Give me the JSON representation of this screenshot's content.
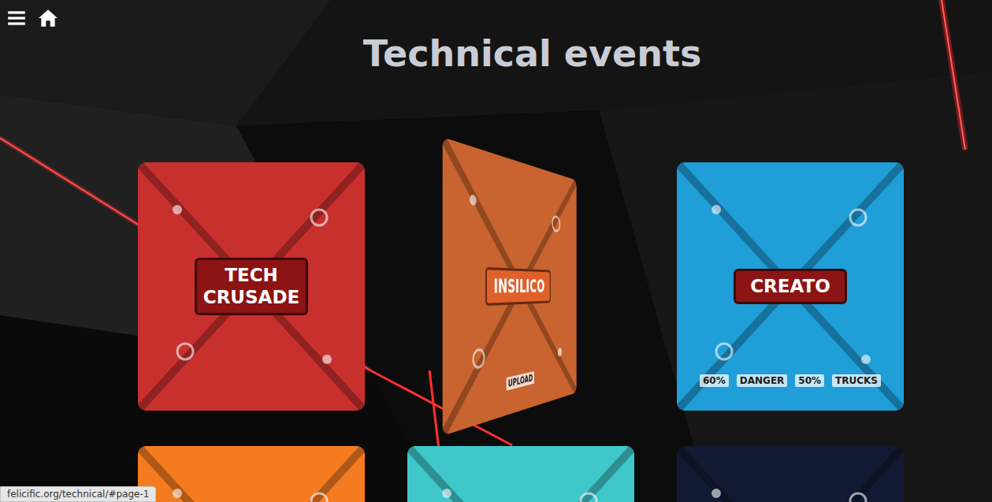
{
  "page": {
    "title": "Technical events"
  },
  "events": [
    {
      "label": "TECH CRUSADE",
      "color": "#c8302e",
      "flipped": false,
      "tags": []
    },
    {
      "label": "INSILICO",
      "color": "#c9632f",
      "flipped": true,
      "tags": [
        "UPLOAD"
      ]
    },
    {
      "label": "CREATO",
      "color": "#1f9ed8",
      "flipped": false,
      "tags": [
        "60%",
        "DANGER",
        "50%",
        "TRUCKS"
      ]
    },
    {
      "color": "#f47b20",
      "flipped": false,
      "tags": []
    },
    {
      "color": "#3fc7c9",
      "flipped": false,
      "tags": []
    },
    {
      "color": "#121a33",
      "flipped": false,
      "tags": []
    }
  ],
  "status_bar": {
    "url": "felicific.org/technical/#page-1"
  }
}
